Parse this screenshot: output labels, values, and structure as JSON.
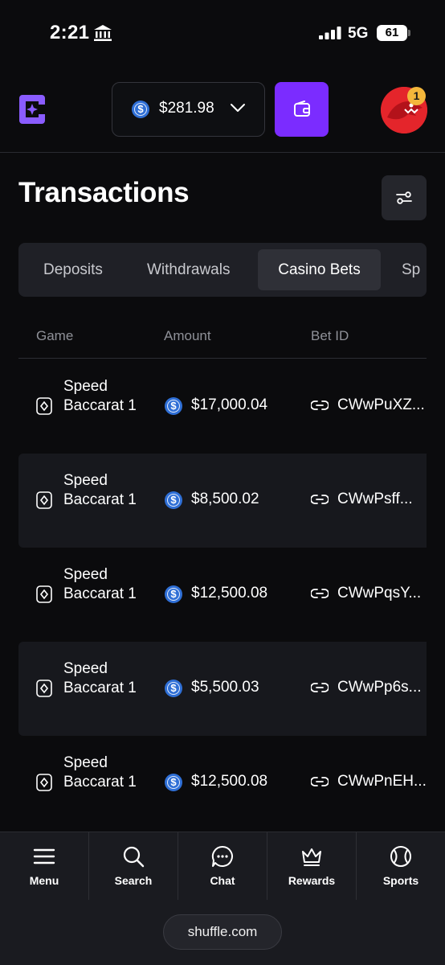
{
  "status_bar": {
    "time": "2:21",
    "network": "5G",
    "battery": "61"
  },
  "header": {
    "balance": "$281.98",
    "notification_count": "1"
  },
  "page": {
    "title": "Transactions"
  },
  "tabs": [
    {
      "label": "Deposits"
    },
    {
      "label": "Withdrawals"
    },
    {
      "label": "Casino Bets",
      "active": true
    },
    {
      "label": "Sp"
    }
  ],
  "table": {
    "columns": [
      "Game",
      "Amount",
      "Bet ID"
    ],
    "rows": [
      {
        "game": "Speed Baccarat 1",
        "amount": "$17,000.04",
        "bet_id": "CWwPuXZ..."
      },
      {
        "game": "Speed Baccarat 1",
        "amount": "$8,500.02",
        "bet_id": "CWwPsff..."
      },
      {
        "game": "Speed Baccarat 1",
        "amount": "$12,500.08",
        "bet_id": "CWwPqsY..."
      },
      {
        "game": "Speed Baccarat 1",
        "amount": "$5,500.03",
        "bet_id": "CWwPp6s..."
      },
      {
        "game": "Speed Baccarat 1",
        "amount": "$12,500.08",
        "bet_id": "CWwPnEH..."
      }
    ]
  },
  "bottom_nav": [
    {
      "label": "Menu",
      "icon": "menu-icon"
    },
    {
      "label": "Search",
      "icon": "search-icon"
    },
    {
      "label": "Chat",
      "icon": "chat-icon"
    },
    {
      "label": "Rewards",
      "icon": "crown-icon"
    },
    {
      "label": "Sports",
      "icon": "tennis-ball-icon"
    }
  ],
  "browser": {
    "url": "shuffle.com"
  },
  "colors": {
    "accent": "#7b2cff",
    "background": "#0b0b0d",
    "surface": "#1f2026",
    "usdc": "#2f6fd6",
    "badge": "#f4b73b"
  }
}
